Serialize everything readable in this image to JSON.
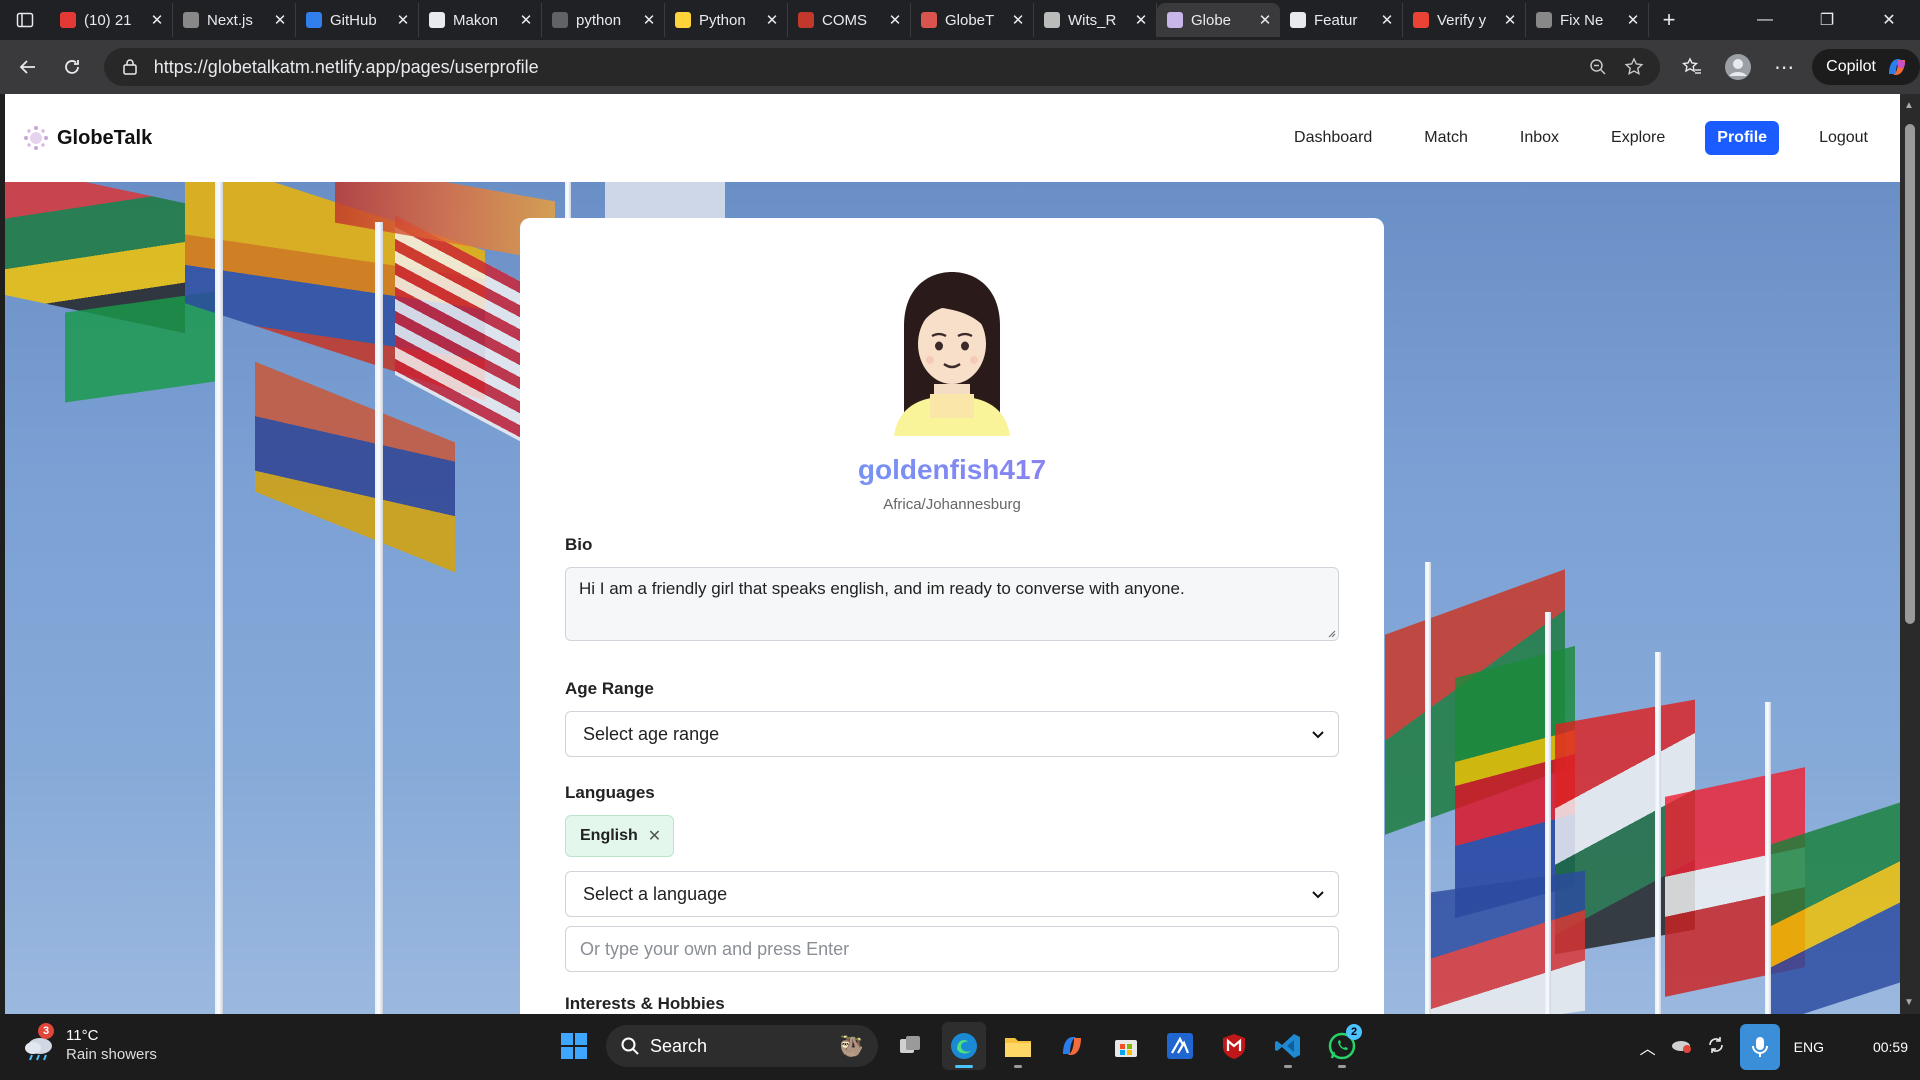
{
  "browser": {
    "tabs": [
      {
        "title": "(10) 21",
        "favicon_color": "#e53935"
      },
      {
        "title": "Next.js",
        "favicon_color": "#888888"
      },
      {
        "title": "GitHub",
        "favicon_color": "#2f80ed"
      },
      {
        "title": "Makon",
        "favicon_color": "#e8eaed"
      },
      {
        "title": "python",
        "favicon_color": "#5f6368"
      },
      {
        "title": "Python",
        "favicon_color": "#ffd43b"
      },
      {
        "title": "COMS",
        "favicon_color": "#c0392b"
      },
      {
        "title": "GlobeT",
        "favicon_color": "#d9534f"
      },
      {
        "title": "Wits_R",
        "favicon_color": "#bbbbbb"
      },
      {
        "title": "Globe",
        "favicon_color": "#c9b6e8",
        "active": true
      },
      {
        "title": "Featur",
        "favicon_color": "#e8eaed"
      },
      {
        "title": "Verify y",
        "favicon_color": "#ea4335"
      },
      {
        "title": "Fix Ne",
        "favicon_color": "#888888"
      }
    ],
    "url": "https://globetalkatm.netlify.app/pages/userprofile",
    "copilot_label": "Copilot"
  },
  "app": {
    "brand": "GlobeTalk",
    "nav": [
      {
        "label": "Dashboard"
      },
      {
        "label": "Match"
      },
      {
        "label": "Inbox"
      },
      {
        "label": "Explore"
      },
      {
        "label": "Profile",
        "active": true
      },
      {
        "label": "Logout"
      }
    ]
  },
  "profile": {
    "username": "goldenfish417",
    "timezone": "Africa/Johannesburg",
    "bio_label": "Bio",
    "bio_value": "Hi I am a friendly girl that speaks english, and im ready to converse with anyone.",
    "age_label": "Age Range",
    "age_value": "Select age range",
    "languages_label": "Languages",
    "languages": [
      "English"
    ],
    "language_select": "Select a language",
    "language_input_placeholder": "Or type your own and press Enter",
    "interests_label": "Interests & Hobbies"
  },
  "taskbar": {
    "weather_temp": "11°C",
    "weather_cond": "Rain showers",
    "weather_badge": "3",
    "search_label": "Search",
    "whatsapp_badge": "2",
    "lang": "ENG",
    "time": "00:59"
  },
  "colors": {
    "accent": "#1a5cff",
    "username_gradient": [
      "#5aa9f5",
      "#a56cf0"
    ],
    "chip_bg": "#e3f7ec"
  }
}
